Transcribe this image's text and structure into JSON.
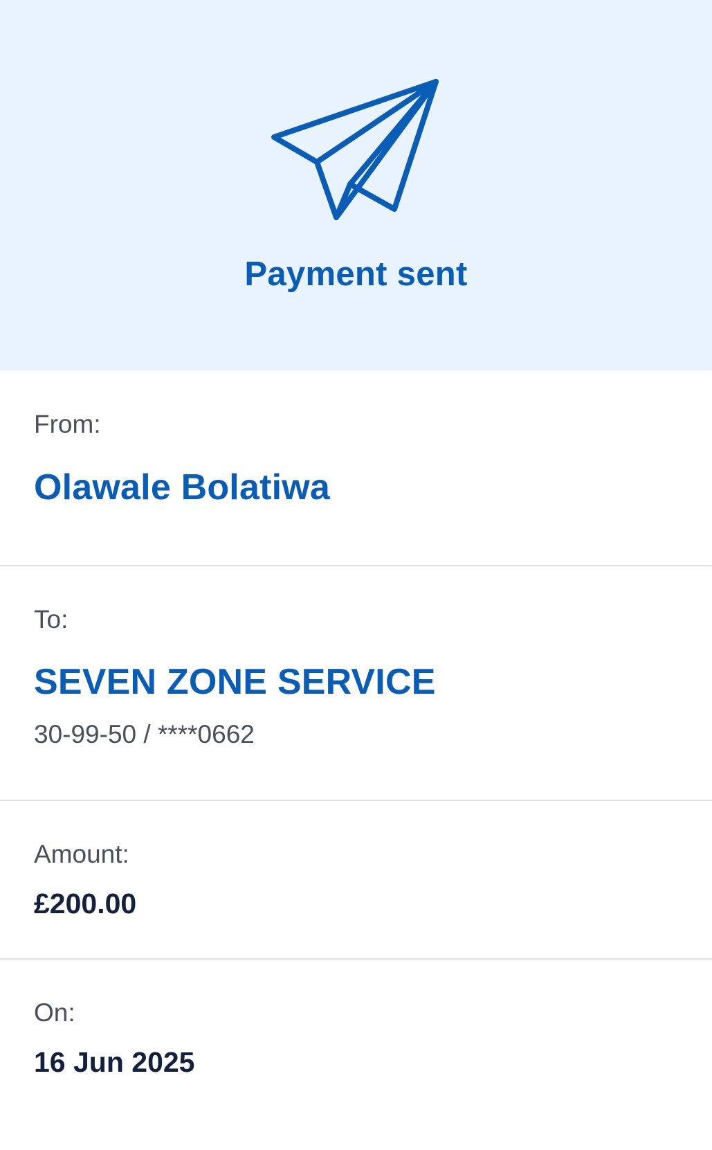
{
  "header": {
    "title": "Payment sent",
    "icon": "paper-plane-icon",
    "icon_color": "#0a5db6",
    "background_color": "#e8f3fd"
  },
  "from": {
    "label": "From:",
    "name": "Olawale Bolatiwa"
  },
  "to": {
    "label": "To:",
    "name": "SEVEN ZONE SERVICE",
    "account": "30-99-50 / ****0662"
  },
  "amount": {
    "label": "Amount:",
    "value": "£200.00"
  },
  "date": {
    "label": "On:",
    "value": "16 Jun 2025"
  }
}
